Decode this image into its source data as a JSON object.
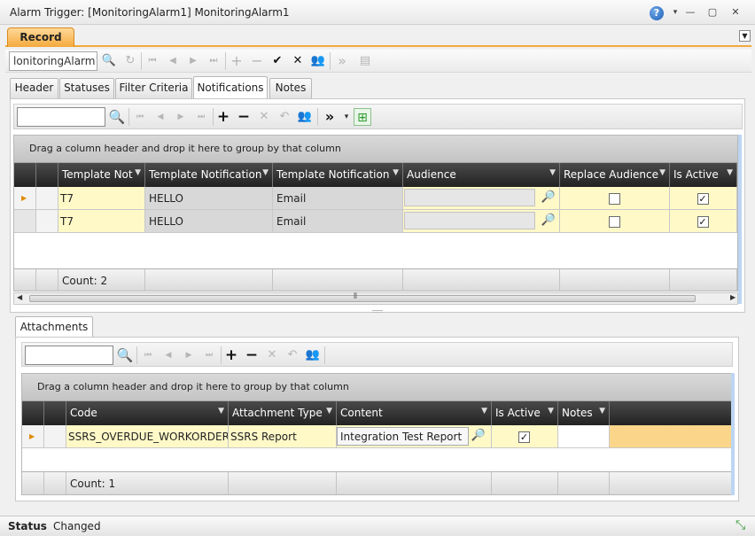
{
  "window": {
    "title": "Alarm Trigger: [MonitoringAlarm1] MonitoringAlarm1",
    "help_label": "?",
    "dropdown_glyph": "▾",
    "minimize_glyph": "—",
    "maximize_glyph": "▢",
    "close_glyph": "✕"
  },
  "record": {
    "tab_label": "Record",
    "collapse_glyph": "▼",
    "id_value": "lonitoringAlarm1"
  },
  "tabs": [
    {
      "label": "Header"
    },
    {
      "label": "Statuses"
    },
    {
      "label": "Filter Criteria"
    },
    {
      "label": "Notifications"
    },
    {
      "label": "Notes"
    }
  ],
  "icons": {
    "search": "🔍",
    "refresh": "↻",
    "first": "⏮",
    "prev": "◀",
    "next": "▶",
    "last": "⏭",
    "add": "+",
    "remove": "−",
    "confirm": "✔",
    "cancel": "✕",
    "undo": "↶",
    "users": "👥",
    "more": "»",
    "more_dropdown": "▾",
    "doc": "▤",
    "new_row": "⊞",
    "filter": "▼",
    "lookup": "🔎",
    "row_indicator": "▶",
    "check": "✓",
    "scroll_left": "◀",
    "scroll_right": "▶",
    "scroll_grip": "⦀",
    "resize": "⤡"
  },
  "notifications": {
    "search_value": "",
    "group_hint": "Drag a column header and drop it here to group by that column",
    "columns": [
      "Template Not",
      "Template Notification",
      "Template Notification",
      "Audience",
      "Replace Audience",
      "Is Active"
    ],
    "rows": [
      {
        "template": "T7",
        "notification": "HELLO",
        "type": "Email",
        "audience": "",
        "replace": false,
        "active": true
      },
      {
        "template": "T7",
        "notification": "HELLO",
        "type": "Email",
        "audience": "",
        "replace": false,
        "active": true
      }
    ],
    "count_label": "Count: 2"
  },
  "attachments": {
    "tab_label": "Attachments",
    "search_value": "",
    "group_hint": "Drag a column header and drop it here to group by that column",
    "columns": [
      "Code",
      "Attachment Type",
      "Content",
      "Is Active",
      "Notes"
    ],
    "rows": [
      {
        "code": "SSRS_OVERDUE_WORKORDERS",
        "type": "SSRS Report",
        "content": "Integration Test Report",
        "active": true,
        "notes": ""
      }
    ],
    "count_label": "Count: 1"
  },
  "status": {
    "label": "Status",
    "value": "Changed"
  },
  "colors": {
    "accent": "#f4a93c",
    "header_dark": "#2b2b2b",
    "row_highlight": "#fff9c8",
    "row_selected_tail": "#fbd68a"
  }
}
